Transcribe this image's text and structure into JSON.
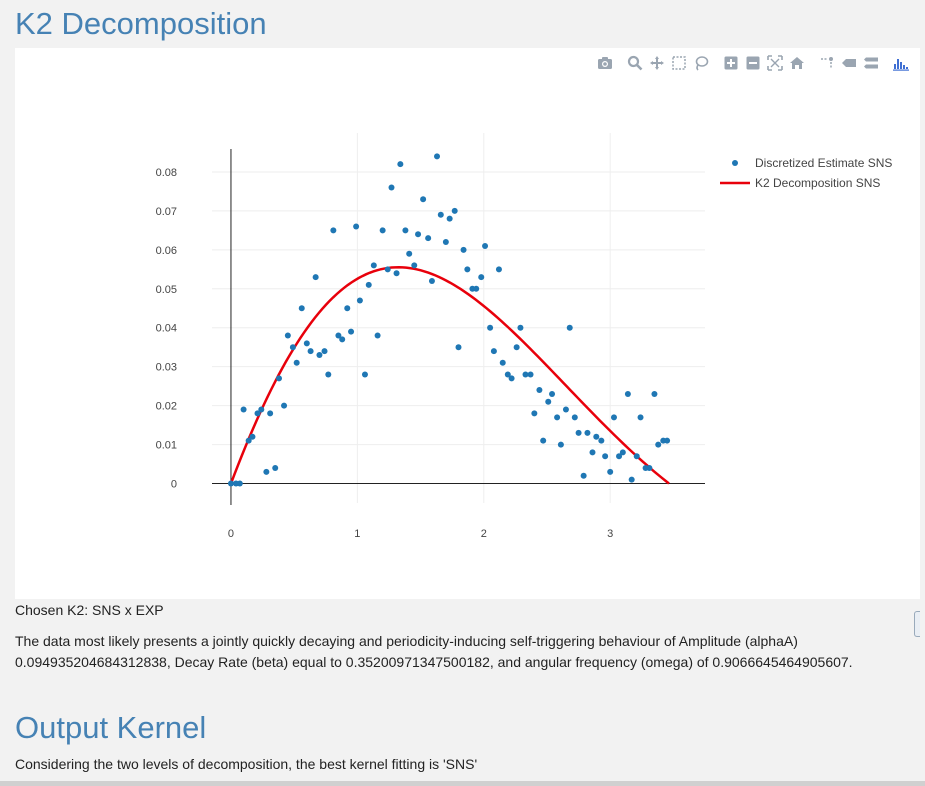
{
  "page": {
    "title": "K2 Decomposition",
    "caption": "Chosen K2: SNS x EXP",
    "paragraph": "The data most likely presents a jointly quickly decaying and periodicity-inducing self-triggering behaviour of Amplitude (alphaA) 0.094935204684312838, Decay Rate (beta) equal to 0.35200971347500182, and angular frequency (omega) of 0.9066645464905607.",
    "section_title": "Output Kernel",
    "conclusion": "Considering the two levels of decomposition, the best kernel fitting is 'SNS'"
  },
  "modebar": {
    "icons": [
      "camera-icon",
      "zoom-icon",
      "pan-icon",
      "box-select-icon",
      "lasso-icon",
      "zoom-in-icon",
      "zoom-out-icon",
      "autoscale-icon",
      "reset-axes-icon",
      "spike-lines-icon",
      "hover-closest-icon",
      "hover-compare-icon",
      "plotly-logo-icon"
    ],
    "color": "#9aa5b1",
    "logo_color": "#3f6fd3"
  },
  "chart_data": {
    "type": "scatter",
    "xlim": [
      -0.15,
      3.75
    ],
    "ylim": [
      -0.005,
      0.09
    ],
    "xticks": [
      0,
      1,
      2,
      3
    ],
    "yticks": [
      0,
      0.01,
      0.02,
      0.03,
      0.04,
      0.05,
      0.06,
      0.07,
      0.08
    ],
    "xtick_labels": [
      "0",
      "1",
      "2",
      "3"
    ],
    "ytick_labels": [
      "0",
      "0.01",
      "0.02",
      "0.03",
      "0.04",
      "0.05",
      "0.06",
      "0.07",
      "0.08"
    ],
    "grid": true,
    "legend_position": "top-right",
    "series": [
      {
        "name": "Discretized Estimate SNS",
        "mode": "markers",
        "color": "#1f77b4",
        "points": [
          [
            0.0,
            0.0
          ],
          [
            0.04,
            0.0
          ],
          [
            0.07,
            0.0
          ],
          [
            0.1,
            0.019
          ],
          [
            0.14,
            0.011
          ],
          [
            0.17,
            0.012
          ],
          [
            0.21,
            0.018
          ],
          [
            0.24,
            0.019
          ],
          [
            0.28,
            0.003
          ],
          [
            0.31,
            0.018
          ],
          [
            0.35,
            0.004
          ],
          [
            0.38,
            0.027
          ],
          [
            0.42,
            0.02
          ],
          [
            0.45,
            0.038
          ],
          [
            0.49,
            0.035
          ],
          [
            0.52,
            0.031
          ],
          [
            0.56,
            0.045
          ],
          [
            0.6,
            0.036
          ],
          [
            0.63,
            0.034
          ],
          [
            0.67,
            0.053
          ],
          [
            0.7,
            0.033
          ],
          [
            0.74,
            0.034
          ],
          [
            0.77,
            0.028
          ],
          [
            0.81,
            0.065
          ],
          [
            0.85,
            0.038
          ],
          [
            0.88,
            0.037
          ],
          [
            0.92,
            0.045
          ],
          [
            0.95,
            0.039
          ],
          [
            0.99,
            0.066
          ],
          [
            1.02,
            0.047
          ],
          [
            1.06,
            0.028
          ],
          [
            1.09,
            0.051
          ],
          [
            1.13,
            0.056
          ],
          [
            1.16,
            0.038
          ],
          [
            1.2,
            0.065
          ],
          [
            1.24,
            0.055
          ],
          [
            1.27,
            0.076
          ],
          [
            1.31,
            0.054
          ],
          [
            1.34,
            0.082
          ],
          [
            1.38,
            0.065
          ],
          [
            1.41,
            0.059
          ],
          [
            1.45,
            0.056
          ],
          [
            1.48,
            0.064
          ],
          [
            1.52,
            0.073
          ],
          [
            1.56,
            0.063
          ],
          [
            1.59,
            0.052
          ],
          [
            1.63,
            0.084
          ],
          [
            1.66,
            0.069
          ],
          [
            1.7,
            0.062
          ],
          [
            1.73,
            0.068
          ],
          [
            1.77,
            0.07
          ],
          [
            1.8,
            0.035
          ],
          [
            1.84,
            0.06
          ],
          [
            1.87,
            0.055
          ],
          [
            1.91,
            0.05
          ],
          [
            1.94,
            0.05
          ],
          [
            1.98,
            0.053
          ],
          [
            2.01,
            0.061
          ],
          [
            2.05,
            0.04
          ],
          [
            2.08,
            0.034
          ],
          [
            2.12,
            0.055
          ],
          [
            2.15,
            0.031
          ],
          [
            2.19,
            0.028
          ],
          [
            2.22,
            0.027
          ],
          [
            2.26,
            0.035
          ],
          [
            2.29,
            0.04
          ],
          [
            2.33,
            0.028
          ],
          [
            2.37,
            0.028
          ],
          [
            2.4,
            0.018
          ],
          [
            2.44,
            0.024
          ],
          [
            2.47,
            0.011
          ],
          [
            2.51,
            0.021
          ],
          [
            2.54,
            0.023
          ],
          [
            2.58,
            0.017
          ],
          [
            2.61,
            0.01
          ],
          [
            2.65,
            0.019
          ],
          [
            2.68,
            0.04
          ],
          [
            2.72,
            0.017
          ],
          [
            2.75,
            0.013
          ],
          [
            2.79,
            0.002
          ],
          [
            2.82,
            0.013
          ],
          [
            2.86,
            0.008
          ],
          [
            2.89,
            0.012
          ],
          [
            2.93,
            0.011
          ],
          [
            2.96,
            0.007
          ],
          [
            3.0,
            0.003
          ],
          [
            3.03,
            0.017
          ],
          [
            3.07,
            0.007
          ],
          [
            3.1,
            0.008
          ],
          [
            3.14,
            0.023
          ],
          [
            3.17,
            0.001
          ],
          [
            3.21,
            0.007
          ],
          [
            3.24,
            0.017
          ],
          [
            3.28,
            0.004
          ],
          [
            3.31,
            0.004
          ],
          [
            3.35,
            0.023
          ],
          [
            3.38,
            0.01
          ],
          [
            3.42,
            0.011
          ],
          [
            3.45,
            0.011
          ]
        ]
      },
      {
        "name": "K2 Decomposition SNS",
        "mode": "lines",
        "color": "#e8000b",
        "alphaA": 0.09493520468431284,
        "beta": 0.3520097134750018,
        "omega": 0.9066645464905607,
        "x_range": [
          0,
          3.465
        ]
      }
    ]
  }
}
